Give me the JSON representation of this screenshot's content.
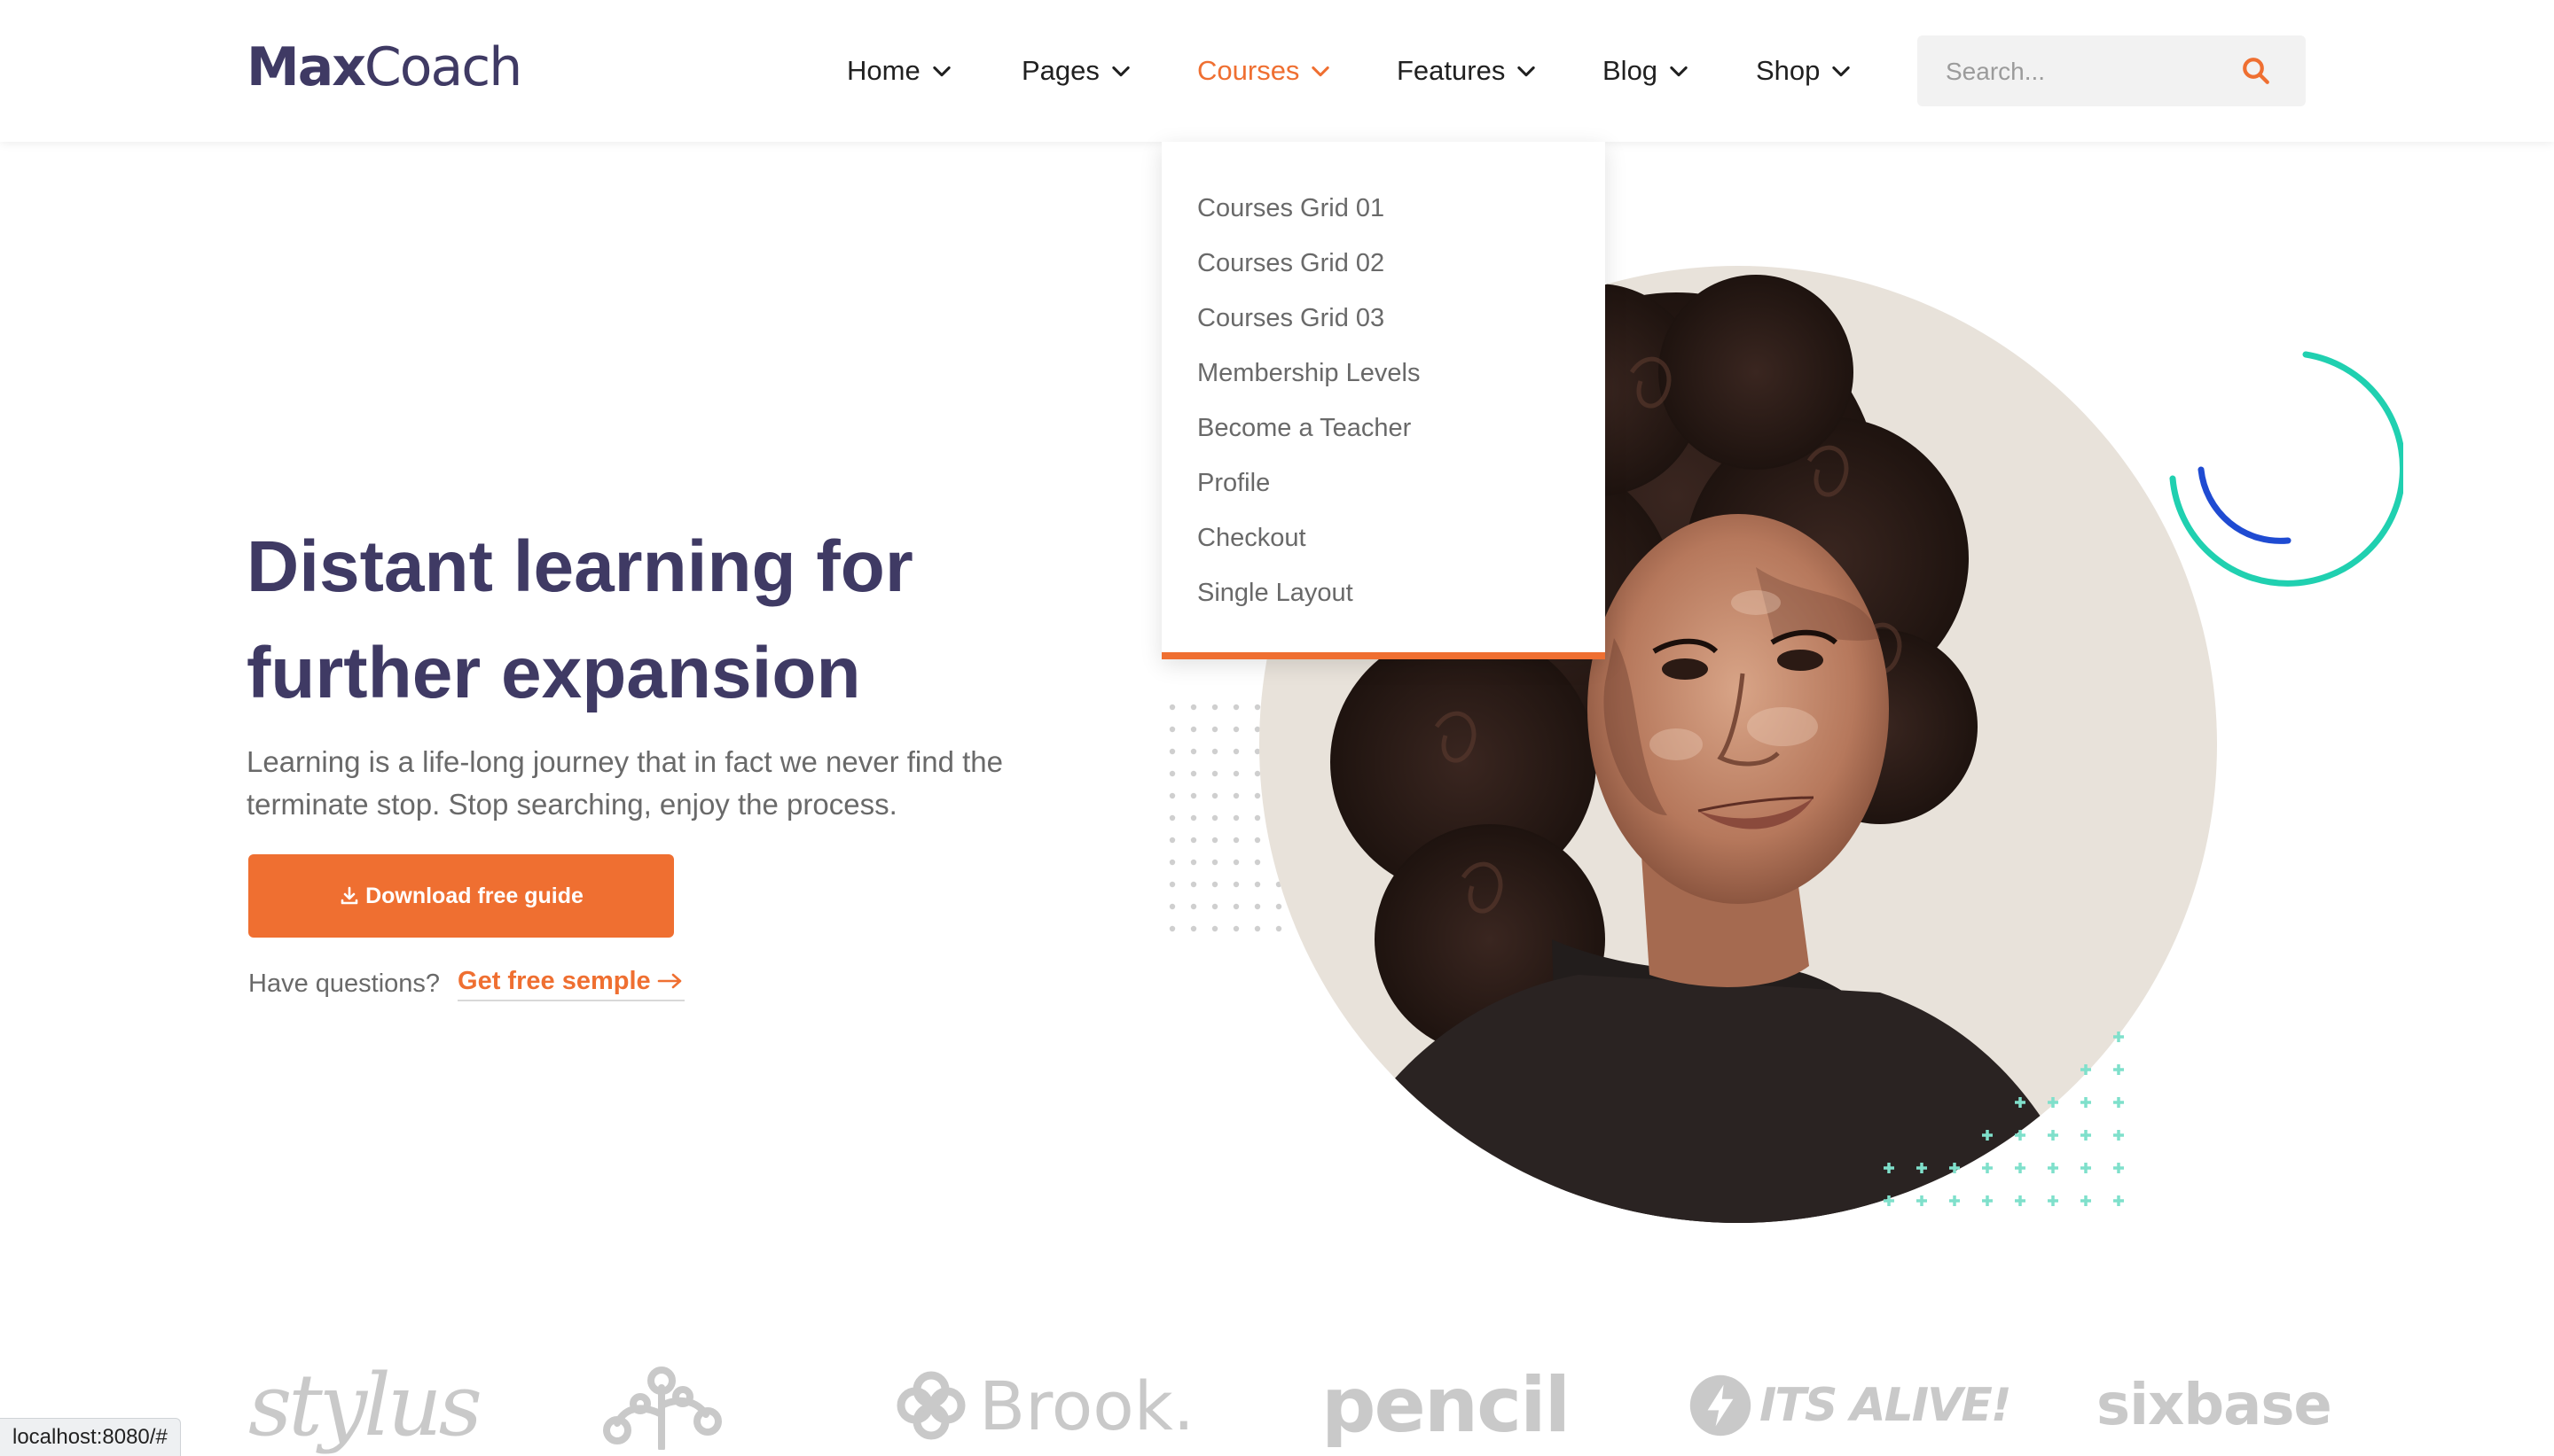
{
  "header": {
    "logo": {
      "part1": "Max",
      "part2": "Coach"
    },
    "nav": [
      {
        "label": "Home",
        "active": false
      },
      {
        "label": "Pages",
        "active": false
      },
      {
        "label": "Courses",
        "active": true
      },
      {
        "label": "Features",
        "active": false
      },
      {
        "label": "Blog",
        "active": false
      },
      {
        "label": "Shop",
        "active": false
      }
    ],
    "search": {
      "placeholder": "Search...",
      "value": ""
    }
  },
  "dropdown": {
    "items": [
      "Courses Grid 01",
      "Courses Grid 02",
      "Courses Grid 03",
      "Membership Levels",
      "Become a Teacher",
      "Profile",
      "Checkout",
      "Single Layout"
    ]
  },
  "hero": {
    "title_line1": "Distant learning for",
    "title_line2": "further expansion",
    "description_line1": "Learning is a life-long journey that in fact we never find the",
    "description_line2": "terminate stop. Stop searching, enjoy the process.",
    "button_label": "Download free guide",
    "questions_text": "Have questions?",
    "link_text": "Get free semple"
  },
  "brands": {
    "stylus": "stylus",
    "brook": "Brook.",
    "pencil": "pencil",
    "alive": "ITS ALIVE!",
    "sixbase": "sixbase"
  },
  "status_bar": {
    "url": "localhost:8080/#"
  },
  "colors": {
    "accent": "#ef6f31",
    "heading": "#3f3a64",
    "body_text": "#696969",
    "teal": "#20d0b0",
    "blue": "#1f4bd2"
  },
  "icons": {
    "chevron": "chevron-down-icon",
    "search": "search-icon",
    "download": "download-icon",
    "arrow": "arrow-right-icon"
  }
}
